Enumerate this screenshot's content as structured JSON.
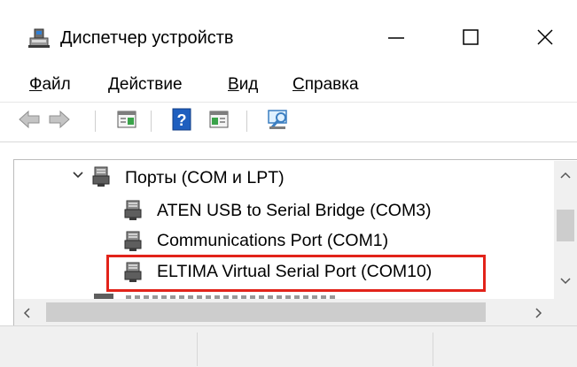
{
  "window": {
    "title": "Диспетчер устройств",
    "icon": "device-manager-icon",
    "controls": [
      "minimize-icon",
      "maximize-icon",
      "close-icon"
    ]
  },
  "menu": {
    "items": [
      {
        "label": "Файл",
        "mnemonic": "Ф"
      },
      {
        "label": "Действие",
        "mnemonic": "Д"
      },
      {
        "label": "Вид",
        "mnemonic": "В"
      },
      {
        "label": "Справка",
        "mnemonic": "С"
      }
    ]
  },
  "toolbar": {
    "buttons": [
      {
        "icon": "back-arrow-icon",
        "enabled": false
      },
      {
        "icon": "forward-arrow-icon",
        "enabled": false
      },
      {
        "icon": "properties-icon",
        "enabled": true
      },
      {
        "icon": "help-icon",
        "enabled": true
      },
      {
        "icon": "update-driver-icon",
        "enabled": true
      },
      {
        "icon": "scan-hardware-icon",
        "enabled": true
      }
    ]
  },
  "tree": {
    "category": {
      "label": "Порты (COM и LPT)",
      "expanded": true,
      "icon": "port-icon"
    },
    "devices": [
      {
        "label": "ATEN USB to Serial Bridge (COM3)",
        "icon": "port-icon"
      },
      {
        "label": "Communications Port (COM1)",
        "icon": "port-icon"
      },
      {
        "label": "ELTIMA Virtual Serial Port (COM10)",
        "icon": "port-icon",
        "highlighted": true
      }
    ]
  },
  "colors": {
    "highlight": "#e2231a",
    "help_icon_blue": "#1f5fbf",
    "scrollbar_track": "#f0f0f0",
    "scrollbar_thumb": "#cdcdcd"
  }
}
